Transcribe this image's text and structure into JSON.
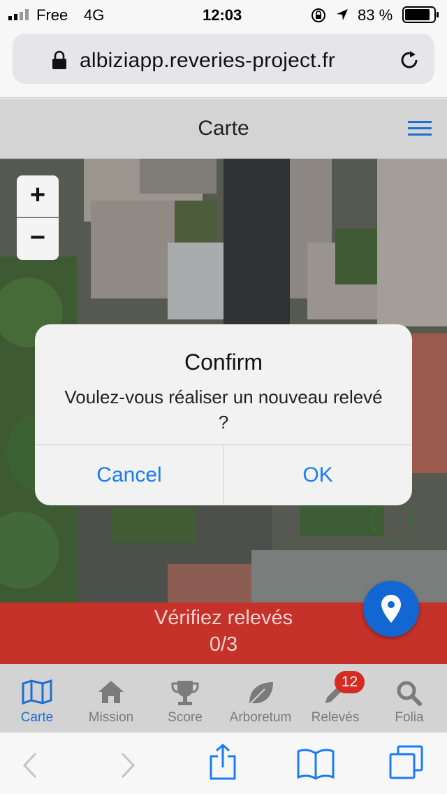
{
  "status": {
    "carrier": "Free",
    "network": "4G",
    "time": "12:03",
    "battery": "83 %"
  },
  "browser": {
    "url": "albiziapp.reveries-project.fr"
  },
  "header": {
    "title": "Carte"
  },
  "map": {
    "zoom_in": "+",
    "zoom_out": "−"
  },
  "dialog": {
    "title": "Confirm",
    "message": "Voulez-vous réaliser un nouveau relevé ?",
    "cancel": "Cancel",
    "ok": "OK"
  },
  "verify": {
    "line1": "Vérifiez relevés",
    "line2": "0/3"
  },
  "tabs": [
    {
      "label": "Carte",
      "icon": "map-icon"
    },
    {
      "label": "Mission",
      "icon": "home-icon"
    },
    {
      "label": "Score",
      "icon": "trophy-icon"
    },
    {
      "label": "Arboretum",
      "icon": "leaf-icon"
    },
    {
      "label": "Relevés",
      "icon": "pencil-icon",
      "badge": "12"
    },
    {
      "label": "Folia",
      "icon": "search-icon"
    }
  ],
  "colors": {
    "accent": "#1a7cf5",
    "verify_bar": "#c53229",
    "fab": "#1267d2",
    "badge": "#d52b22"
  }
}
